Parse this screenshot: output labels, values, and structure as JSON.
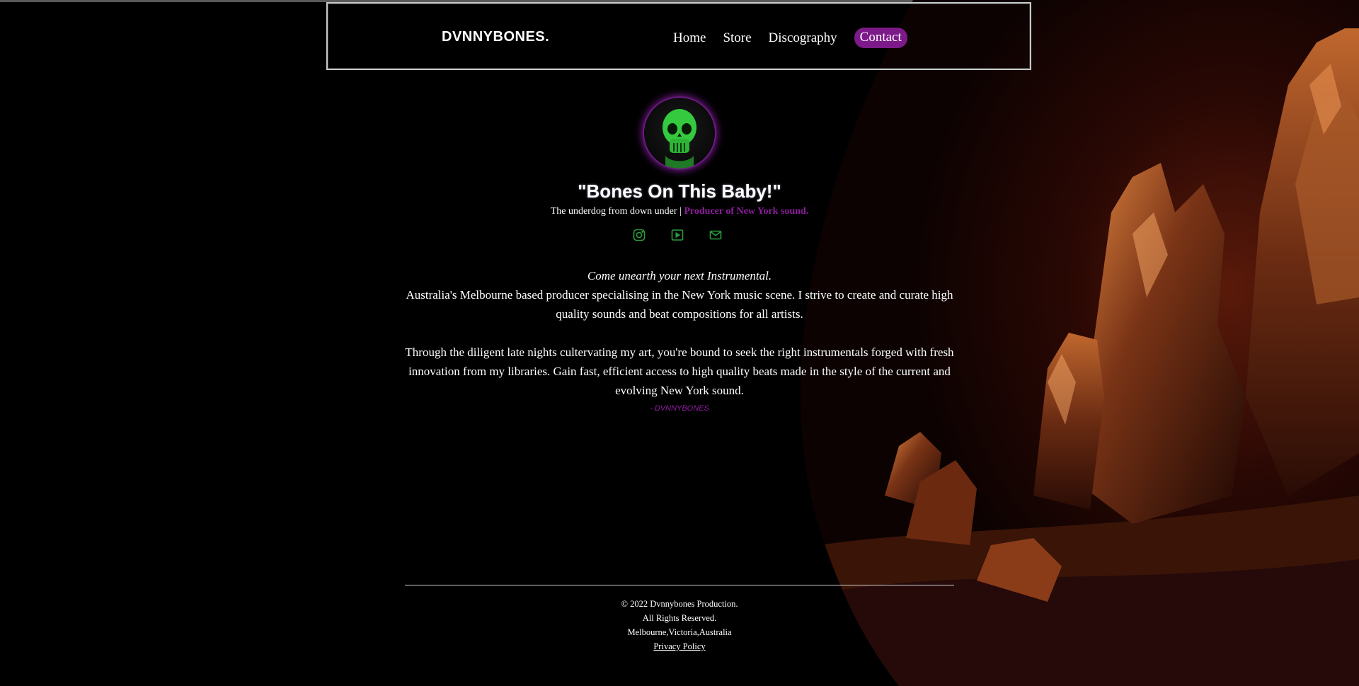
{
  "header": {
    "brand": "DVNNYBONES.",
    "nav": [
      "Home",
      "Store",
      "Discography",
      "Contact"
    ]
  },
  "hero": {
    "avatar_icon": "green-skull-icon",
    "tagline": "\"Bones On This Baby!\"",
    "subtitle_prefix": "The underdog from down under | ",
    "subtitle_accent": "Producer of New York sound.",
    "socials": [
      "instagram-icon",
      "youtube-icon",
      "mail-icon"
    ]
  },
  "about": {
    "lead": "Come unearth your next Instrumental.",
    "paragraph1": "Australia's Melbourne based producer specialising in the New York music scene. I strive to create and curate high quality sounds and beat compositions for all artists.",
    "paragraph2": "Through the diligent late nights cultervating my art, you're bound to seek the right instrumentals forged with fresh innovation from my libraries. Gain fast, efficient access to high quality beats made in the style of the current and evolving New York sound.",
    "signature": "- DVNNYBONES"
  },
  "footer": {
    "copyright": "© 2022 Dvnnybones Production.",
    "rights": "All Rights Reserved.",
    "location": "Melbourne,Victoria,Australia",
    "privacy": "Privacy Policy"
  },
  "colors": {
    "accent": "#8e1d9e",
    "social": "#2c9e3c",
    "skull": "#3fd94a"
  }
}
